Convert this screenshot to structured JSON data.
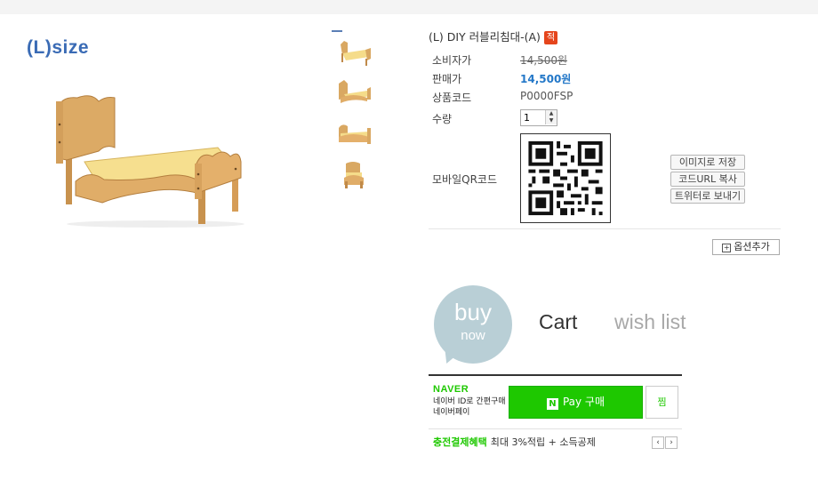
{
  "image": {
    "size_label": "(L)size"
  },
  "product": {
    "title": "(L) DIY 러블리침대-(A)",
    "badge": "적",
    "rows": {
      "consumer_price_label": "소비자가",
      "consumer_price": "14,500원",
      "sale_price_label": "판매가",
      "sale_price": "14,500원",
      "code_label": "상품코드",
      "code": "P0000FSP",
      "qty_label": "수량",
      "qty_value": "1",
      "qr_label": "모바일QR코드"
    },
    "qr_buttons": [
      "이미지로 저장",
      "코드URL 복사",
      "트위터로 보내기"
    ],
    "option_button": "옵션추가"
  },
  "actions": {
    "buy": "buy",
    "buy_sub": "now",
    "cart": "Cart",
    "wish": "wish list"
  },
  "naver": {
    "logo": "NAVER",
    "desc_line1": "네이버 ID로 간편구매",
    "desc_line2": "네이버페이",
    "pay_button": "Pay 구매",
    "pay_n": "N",
    "zzim": "찜",
    "benefit_highlight": "충전결제혜택",
    "benefit_text": "최대 3%적립 + 소득공제",
    "prev": "‹",
    "next": "›"
  },
  "colors": {
    "price": "#2478c8",
    "naver_green": "#1ec800",
    "badge": "#e5451c",
    "buy_bubble": "#b9cfd6"
  }
}
